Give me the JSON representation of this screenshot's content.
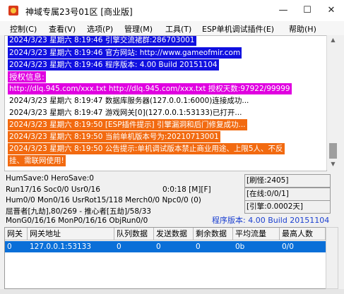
{
  "window": {
    "title": "神域专属23号01区 [商业版]",
    "minimize": "—",
    "maximize": "☐",
    "close": "✕"
  },
  "menu": [
    {
      "label": "控制(C)"
    },
    {
      "label": "查看(V)"
    },
    {
      "label": "选项(P)"
    },
    {
      "label": "管理(M)"
    },
    {
      "label": "工具(T)"
    },
    {
      "label": "ESP单机调试插件(E)"
    },
    {
      "label": "帮助(H)"
    }
  ],
  "log": [
    {
      "text": "2024/3/23 星期六 8:19:46 引擎交流裙群:286703001",
      "bg": "#1010e0",
      "color": "#ffffff"
    },
    {
      "text": "2024/3/23 星期六 8:19:46 官方网站: http://www.gameofmir.com",
      "bg": "#1010e0",
      "color": "#ffffff"
    },
    {
      "text": "2024/3/23 星期六 8:19:46 程序版本: 4.00 Build 20151104",
      "bg": "#1010e0",
      "color": "#ffffff"
    },
    {
      "text": "授权信息:",
      "bg": "#e000e0",
      "color": "#ffffff"
    },
    {
      "text": "http://dlq.945.com/xxx.txt http://dlq.945.com/xxx.txt 授权天数:97922/99999",
      "bg": "#e000e0",
      "color": "#ffffff"
    },
    {
      "text": "2024/3/23 星期六 8:19:47 数据库服务器(127.0.0.1:6000)连接成功...",
      "bg": "#ffffff",
      "color": "#000000"
    },
    {
      "text": "2024/3/23 星期六 8:19:47 游戏网关[0](127.0.0.1:53133)已打开...",
      "bg": "#ffffff",
      "color": "#000000"
    },
    {
      "text": "2024/3/23 星期六 8:19:50 [ESP插件提示] 引擎漏洞和后门修复成功...",
      "bg": "#f26a10",
      "color": "#ffffff"
    },
    {
      "text": "2024/3/23 星期六 8:19:50 当前单机版本号为:20210713001",
      "bg": "#f26a10",
      "color": "#ffffff"
    },
    {
      "text": "2024/3/23 星期六 8:19:50 公告提示:单机调试版本禁止商业用途、上限5人、不反",
      "bg": "#f26a10",
      "color": "#ffffff"
    },
    {
      "text": "挂、需联网使用!",
      "bg": "#f26a10",
      "color": "#ffffff"
    }
  ],
  "stats": {
    "line1": "HumSave:0 HeroSave:0",
    "line2": "Run17/16 Soc0/0 Usr0/16",
    "time": "0:0:18 [M][F]",
    "line3": "Hum0/0 Mon0/16 UsrRot15/118 Merch0/0 Npc0/0 (0)",
    "line4": "屈晋者[九劫],80/269 - 推心者[五劫]/58/33",
    "line5": "MonG0/16/16 MonP0/16/16 ObjRun0/0",
    "refresh": "[刷怪:2405]",
    "online": "[在线:0/0/1]",
    "burst": "[引擎:0.0002天]",
    "version": "程序版本: 4.00 Build 20151104",
    "version_color": "#1a3fd0"
  },
  "gates": {
    "headers": [
      "网关",
      "网关地址",
      "队列数据",
      "发送数据",
      "剩余数据",
      "平均流量",
      "最高人数"
    ],
    "rows": [
      [
        "0",
        "127.0.0.1:53133",
        "0",
        "0",
        "0",
        "0b",
        "0/0"
      ]
    ],
    "selected_color": "#0a6fd8"
  }
}
